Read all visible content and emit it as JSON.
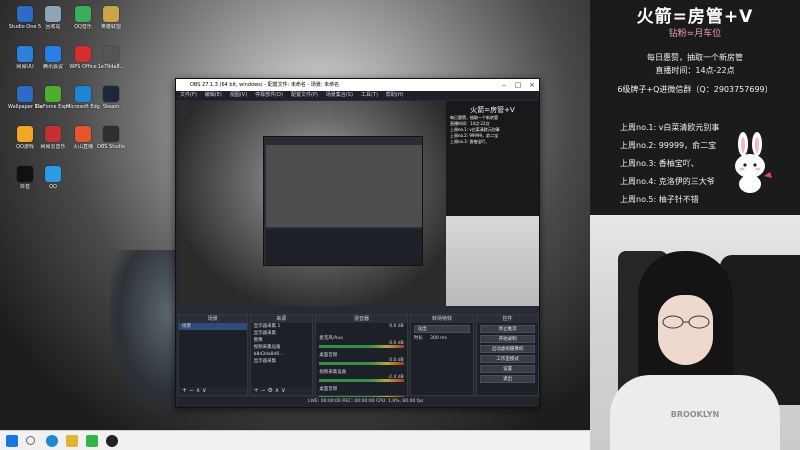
{
  "desktop": {
    "icons": [
      {
        "label": "Studio One 5",
        "color": "#2a6cc8"
      },
      {
        "label": "回收站",
        "color": "#8fa4b9"
      },
      {
        "label": "QQ音乐",
        "color": "#3cae5a"
      },
      {
        "label": "英雄联盟",
        "color": "#c8a64a"
      },
      {
        "label": "网易UU",
        "color": "#2b82d9"
      },
      {
        "label": "腾讯会议",
        "color": "#2a7ee8"
      },
      {
        "label": "WPS Office",
        "color": "#d32f2f"
      },
      {
        "label": "1e79da8...",
        "color": "#555555"
      },
      {
        "label": "Wallpaper Engine",
        "color": "#2a6cc8"
      },
      {
        "label": "GeForce Experience",
        "color": "#4fae2e"
      },
      {
        "label": "Microsoft Edge",
        "color": "#1f86d6"
      },
      {
        "label": "Steam",
        "color": "#1b2838"
      },
      {
        "label": "QQ游戏",
        "color": "#f5a623"
      },
      {
        "label": "网易云音乐",
        "color": "#c62f2f"
      },
      {
        "label": "火山直播",
        "color": "#e8542c"
      },
      {
        "label": "OBS Studio",
        "color": "#302e31"
      },
      {
        "label": "抖音",
        "color": "#111111"
      },
      {
        "label": "QQ",
        "color": "#2b9be8"
      }
    ]
  },
  "obs": {
    "title": "OBS 27.1.3 (64 bit, windows) - 配置文件: 未命名 - 场景: 未命名",
    "menu": [
      "文件(F)",
      "编辑(E)",
      "视图(V)",
      "停靠部件(D)",
      "配置文件(P)",
      "场景集合(S)",
      "工具(T)",
      "帮助(H)"
    ],
    "docks": {
      "scenes_header": "场景",
      "scenes": [
        "场景"
      ],
      "sources_header": "来源",
      "sources": [
        "显示器采集 1",
        "显示器采集",
        "图像",
        "视频采集设备",
        "b8d3da8d6...",
        "显示器采集"
      ],
      "mixer_header": "混音器",
      "mixer": [
        {
          "label": "麦克风/Aux",
          "db": "0.0 dB"
        },
        {
          "label": "桌面音频",
          "db": "0.0 dB"
        },
        {
          "label": "视频采集设备",
          "db": "0.0 dB"
        },
        {
          "label": "桌面音频",
          "db": "-2.4 dB"
        }
      ],
      "transitions_header": "转场特效",
      "transition_name": "淡出",
      "duration_label": "时长",
      "duration_value": "300 ms",
      "controls_header": "控件",
      "controls": [
        "停止推流",
        "开始录制",
        "启动虚拟摄像机",
        "工作室模式",
        "设置",
        "退出"
      ]
    },
    "status": "LIVE: 00:00:00   REC: 00:00:00   CPU: 1.0%, 60.00 fps",
    "preview_info": {
      "title": "火箭=房管+V",
      "lines": [
        "每日惠赞，抽取一个新房管",
        "直播时间：14点-22点",
        "上周no.1: v白菜清欧元别事",
        "上周no.2: 99999，俞二宝",
        "上周no.3: 香柚宝吖、"
      ]
    }
  },
  "panel": {
    "title": "火箭=房管+V",
    "subtitle": "钻粉=月车位",
    "line1": "每日惠赞，抽取一个新房管",
    "line2": "直播时间：14点-22点",
    "line3": "6级牌子+Q进微信群（Q：2903757699）",
    "ranks": [
      "上周no.1: v白菜清欧元别事",
      "上周no.2: 99999，俞二宝",
      "上周no.3: 香柚宝吖、",
      "上周no.4: 克洛伊的三大爷",
      "上周no.5: 柚子针不错"
    ],
    "sweater_text": "BROOKLYN"
  }
}
